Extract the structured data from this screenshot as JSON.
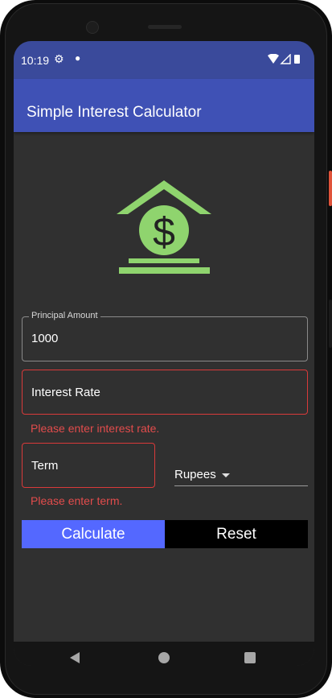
{
  "status_bar": {
    "time": "10:19"
  },
  "app_bar": {
    "title": "Simple Interest Calculator"
  },
  "form": {
    "principal": {
      "label": "Principal Amount",
      "value": "1000"
    },
    "interest_rate": {
      "placeholder": "Interest Rate",
      "error": "Please enter interest rate."
    },
    "term": {
      "placeholder": "Term",
      "error": "Please enter term."
    },
    "currency": {
      "selected": "Rupees"
    }
  },
  "buttons": {
    "calculate": "Calculate",
    "reset": "Reset"
  },
  "icons": [
    "settings-gear-icon",
    "wifi-icon",
    "cellular-signal-icon",
    "battery-icon",
    "bank-dollar-logo-icon",
    "dropdown-caret-icon",
    "nav-back-icon",
    "nav-home-icon",
    "nav-recents-icon"
  ],
  "colors": {
    "app_bar": "#3f51b5",
    "status_bar": "#3a4a9b",
    "background": "#303030",
    "logo_green": "#8fd46e",
    "error_red": "#e24c4c",
    "calculate_button": "#5468ff",
    "reset_button": "#000000"
  }
}
